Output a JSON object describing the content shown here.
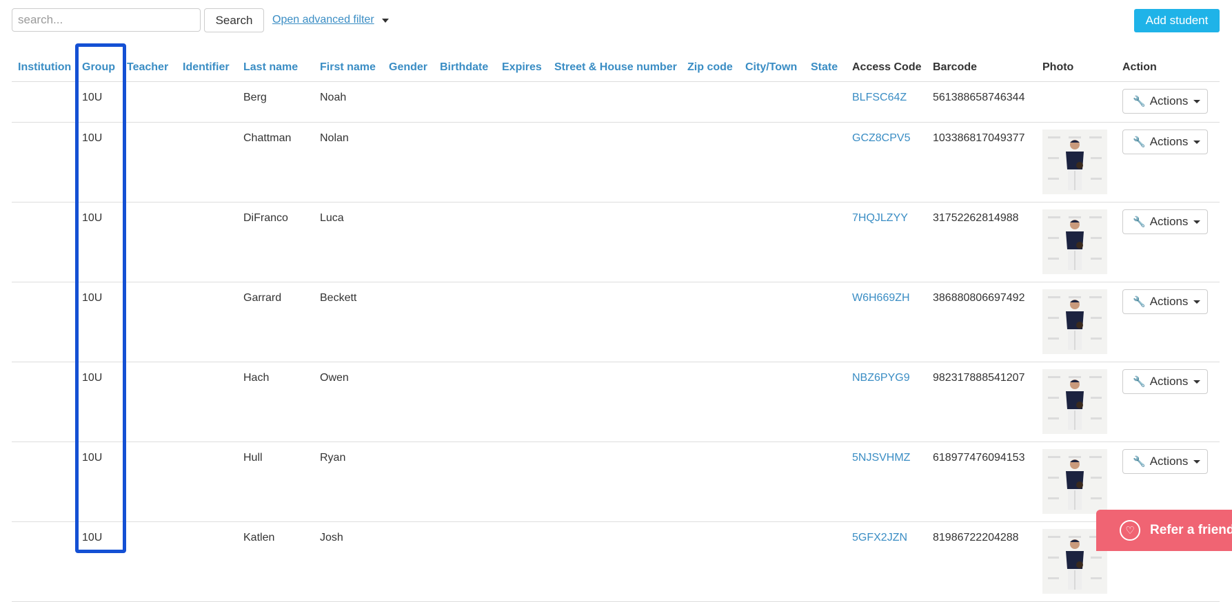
{
  "toolbar": {
    "search_placeholder": "search...",
    "search_button": "Search",
    "advanced_filter": "Open advanced filter",
    "add_student": "Add student"
  },
  "columns": [
    "Institution",
    "Group",
    "Teacher",
    "Identifier",
    "Last name",
    "First name",
    "Gender",
    "Birthdate",
    "Expires",
    "Street & House number",
    "Zip code",
    "City/Town",
    "State",
    "Access Code",
    "Barcode",
    "Photo",
    "Action"
  ],
  "rows": [
    {
      "group": "10U",
      "last_name": "Berg",
      "first_name": "Noah",
      "access_code": "BLFSC64Z",
      "barcode": "561388658746344",
      "photo": false,
      "action": "Actions"
    },
    {
      "group": "10U",
      "last_name": "Chattman",
      "first_name": "Nolan",
      "access_code": "GCZ8CPV5",
      "barcode": "103386817049377",
      "photo": true,
      "action": "Actions"
    },
    {
      "group": "10U",
      "last_name": "DiFranco",
      "first_name": "Luca",
      "access_code": "7HQJLZYY",
      "barcode": "31752262814988",
      "photo": true,
      "action": "Actions"
    },
    {
      "group": "10U",
      "last_name": "Garrard",
      "first_name": "Beckett",
      "access_code": "W6H669ZH",
      "barcode": "386880806697492",
      "photo": true,
      "action": "Actions"
    },
    {
      "group": "10U",
      "last_name": "Hach",
      "first_name": "Owen",
      "access_code": "NBZ6PYG9",
      "barcode": "982317888541207",
      "photo": true,
      "action": "Actions"
    },
    {
      "group": "10U",
      "last_name": "Hull",
      "first_name": "Ryan",
      "access_code": "5NJSVHMZ",
      "barcode": "618977476094153",
      "photo": true,
      "action": "Actions"
    },
    {
      "group": "10U",
      "last_name": "Katlen",
      "first_name": "Josh",
      "access_code": "5GFX2JZN",
      "barcode": "81986722204288",
      "photo": true,
      "action": ""
    }
  ],
  "refer_friend": "Refer a friend",
  "colors": {
    "link": "#3a8dc4",
    "primary": "#1fb3e8",
    "highlight": "#1450d4",
    "refer": "#f06473"
  },
  "icons": {
    "action": "wrench-icon",
    "refer": "heart-chat-icon"
  }
}
